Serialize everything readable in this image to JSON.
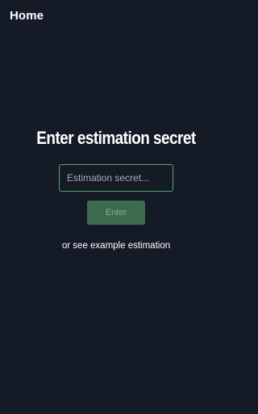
{
  "header": {
    "title": "Home"
  },
  "main": {
    "title": "Enter estimation secret",
    "secret_input": {
      "placeholder": "Estimation secret...",
      "value": ""
    },
    "enter_button": {
      "label": "Enter"
    },
    "example_link": {
      "label": "or see example estimation"
    }
  },
  "colors": {
    "background": "#141a26",
    "accent": "#5aa56f",
    "button_bg": "#3b6a4c",
    "button_text": "#8fa99a"
  }
}
